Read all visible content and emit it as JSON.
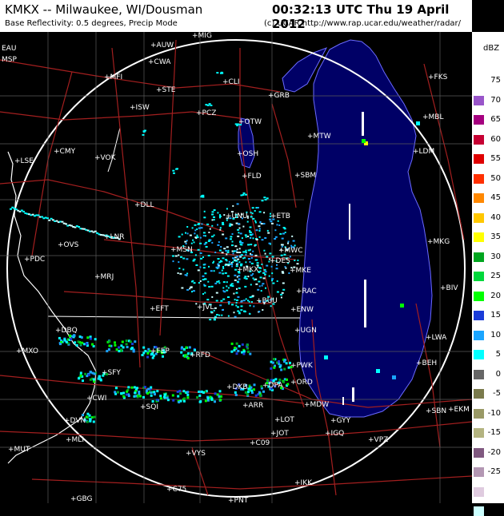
{
  "header": {
    "station": "KMKX -- Milwaukee, WI/Dousman",
    "time": "00:32:13 UTC Thu 19 April 2012",
    "product": "Base Reflectivity: 0.5 degrees, Precip Mode",
    "credit": "(c) UCAR  http://www.rap.ucar.edu/weather/radar/"
  },
  "legend": {
    "unit": "dBZ",
    "levels": [
      {
        "label": "75",
        "color": "#ffffff"
      },
      {
        "label": "70",
        "color": "#9955c9"
      },
      {
        "label": "65",
        "color": "#a5007f"
      },
      {
        "label": "60",
        "color": "#c60033"
      },
      {
        "label": "55",
        "color": "#df0000"
      },
      {
        "label": "50",
        "color": "#ff3000"
      },
      {
        "label": "45",
        "color": "#ff8800"
      },
      {
        "label": "40",
        "color": "#ffc700"
      },
      {
        "label": "35",
        "color": "#ffff00"
      },
      {
        "label": "30",
        "color": "#00a51f"
      },
      {
        "label": "25",
        "color": "#00d83b"
      },
      {
        "label": "20",
        "color": "#00ff00"
      },
      {
        "label": "15",
        "color": "#1a3cd8"
      },
      {
        "label": "10",
        "color": "#1aa5ff"
      },
      {
        "label": "5",
        "color": "#00ffff"
      },
      {
        "label": "0",
        "color": "#666666"
      },
      {
        "label": "-5",
        "color": "#7a7a4c"
      },
      {
        "label": "-10",
        "color": "#999966"
      },
      {
        "label": "-15",
        "color": "#b3b380"
      },
      {
        "label": "-20",
        "color": "#805980"
      },
      {
        "label": "-25",
        "color": "#b397b3"
      },
      {
        "label": "",
        "color": "#dfcbdf"
      },
      {
        "label": "",
        "color": "#ccffff"
      }
    ]
  },
  "cities": [
    {
      "name": "EAU",
      "plus": false
    },
    {
      "name": "MSP",
      "plus": false
    },
    {
      "name": "MFI"
    },
    {
      "name": "STE"
    },
    {
      "name": "CWA"
    },
    {
      "name": "AUW"
    },
    {
      "name": "MIG"
    },
    {
      "name": "CLI"
    },
    {
      "name": "GRB"
    },
    {
      "name": "ISW"
    },
    {
      "name": "PCZ"
    },
    {
      "name": "OTW"
    },
    {
      "name": "MTW"
    },
    {
      "name": "MBL"
    },
    {
      "name": "FKS"
    },
    {
      "name": "CMY"
    },
    {
      "name": "VOK"
    },
    {
      "name": "OSH"
    },
    {
      "name": "LDM"
    },
    {
      "name": "LSE"
    },
    {
      "name": "FLD"
    },
    {
      "name": "SBM"
    },
    {
      "name": "DLL"
    },
    {
      "name": "UNU"
    },
    {
      "name": "ETB"
    },
    {
      "name": "LNR"
    },
    {
      "name": "OVS"
    },
    {
      "name": "MKG"
    },
    {
      "name": "PDC"
    },
    {
      "name": "MSN"
    },
    {
      "name": "MWC"
    },
    {
      "name": "DES"
    },
    {
      "name": "MKX"
    },
    {
      "name": "MKE"
    },
    {
      "name": "MRJ"
    },
    {
      "name": "BIV"
    },
    {
      "name": "RAC"
    },
    {
      "name": "BUU"
    },
    {
      "name": "EFT"
    },
    {
      "name": "JVL"
    },
    {
      "name": "ENW"
    },
    {
      "name": "DBQ"
    },
    {
      "name": "UGN"
    },
    {
      "name": "LWA"
    },
    {
      "name": "MXO"
    },
    {
      "name": "FEP"
    },
    {
      "name": "RFD"
    },
    {
      "name": "BEH"
    },
    {
      "name": "SFY"
    },
    {
      "name": "PWK"
    },
    {
      "name": "ORD"
    },
    {
      "name": "ARR"
    },
    {
      "name": "DPA"
    },
    {
      "name": "DKB"
    },
    {
      "name": "CWI"
    },
    {
      "name": "SQI"
    },
    {
      "name": "MDW"
    },
    {
      "name": "SBN"
    },
    {
      "name": "EKM"
    },
    {
      "name": "DVN"
    },
    {
      "name": "LOT"
    },
    {
      "name": "GYY"
    },
    {
      "name": "MLI"
    },
    {
      "name": "JOT"
    },
    {
      "name": "IGQ"
    },
    {
      "name": "VPZ"
    },
    {
      "name": "C09"
    },
    {
      "name": "MUT"
    },
    {
      "name": "VYS"
    },
    {
      "name": "C75"
    },
    {
      "name": "IKK"
    },
    {
      "name": "GBG"
    },
    {
      "name": "PNT"
    }
  ]
}
